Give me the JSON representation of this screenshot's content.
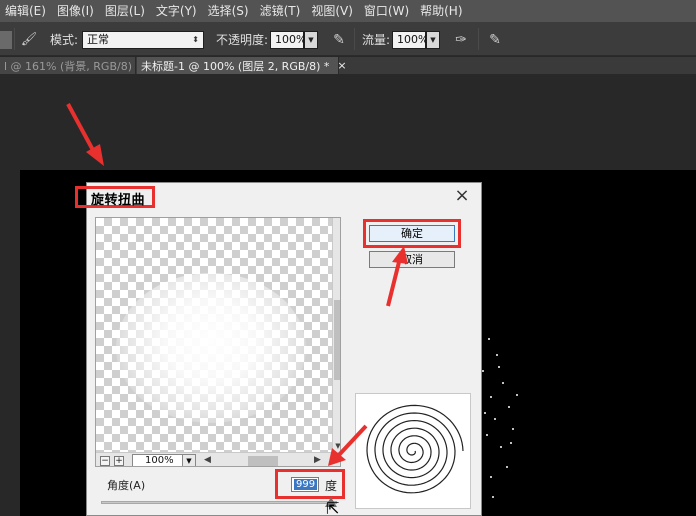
{
  "menubar": {
    "items": [
      "编辑(E)",
      "图像(I)",
      "图层(L)",
      "文字(Y)",
      "选择(S)",
      "滤镜(T)",
      "视图(V)",
      "窗口(W)",
      "帮助(H)"
    ]
  },
  "options": {
    "mode_label": "模式:",
    "mode_value": "正常",
    "opacity_label": "不透明度:",
    "opacity_value": "100%",
    "flow_label": "流量:",
    "flow_value": "100%"
  },
  "tabs": {
    "tab1": "l @ 161% (背景, RGB/8)",
    "tab2": "未标题-1 @ 100% (图层 2, RGB/8) *",
    "close_glyph": "×"
  },
  "dialog": {
    "title": "旋转扭曲",
    "close_glyph": "×",
    "ok_label": "确定",
    "cancel_label": "取消",
    "zoom_minus": "−",
    "zoom_plus": "+",
    "zoom_value": "100%",
    "angle_label": "角度(A)",
    "angle_value": "999",
    "angle_unit": "度"
  },
  "colors": {
    "annotation_red": "#e8312e",
    "accent_blue": "#3b78c4"
  },
  "icons": {
    "brush_preset": "brush-preset-icon",
    "airbrush": "airbrush-icon",
    "pressure_opacity": "pressure-opacity-icon",
    "pressure_flow": "pressure-flow-icon"
  }
}
